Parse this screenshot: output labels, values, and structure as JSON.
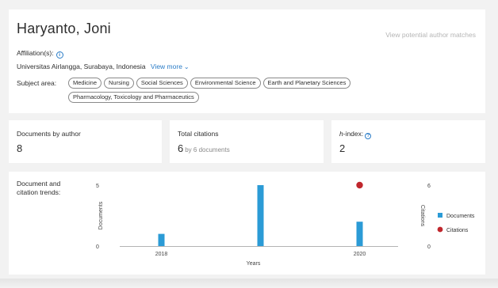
{
  "author": {
    "name": "Haryanto, Joni",
    "potential_matches_link": "View potential author matches",
    "affiliation_label": "Affiliation(s):",
    "affiliation_value": "Universitas Airlangga, Surabaya, Indonesia",
    "view_more": "View more",
    "subject_label": "Subject area:",
    "subjects_row1": [
      "Medicine",
      "Nursing",
      "Social Sciences",
      "Environmental Science",
      "Earth and Planetary Sciences"
    ],
    "subjects_row2": [
      "Pharmacology, Toxicology and Pharmaceutics"
    ]
  },
  "metrics": {
    "documents": {
      "label": "Documents by author",
      "value": "8"
    },
    "citations": {
      "label": "Total citations",
      "value": "6",
      "sub": "by 6 documents"
    },
    "hindex": {
      "label_italic": "h",
      "label_rest": "-index:",
      "value": "2"
    }
  },
  "trends": {
    "label": "Document and citation trends:"
  },
  "colors": {
    "accent": "#2a7cc7",
    "documents": "#2b9bd6",
    "citations": "#c0272d"
  },
  "chart_data": {
    "type": "bar",
    "xlabel": "Years",
    "ylabel_left": "Documents",
    "ylabel_right": "Citations",
    "x_ticks": [
      "2018",
      "2020"
    ],
    "xlim": [
      2017.5,
      2020.5
    ],
    "ylim_left": [
      0,
      5
    ],
    "ylim_right": [
      0,
      6
    ],
    "left_ticks": [
      0,
      5
    ],
    "right_ticks": [
      0,
      6
    ],
    "series": [
      {
        "name": "Documents",
        "type": "bar",
        "axis": "left",
        "x": [
          2018,
          2019,
          2020
        ],
        "values": [
          1,
          5,
          2
        ]
      },
      {
        "name": "Citations",
        "type": "scatter",
        "axis": "right",
        "x": [
          2020
        ],
        "values": [
          6
        ]
      }
    ]
  }
}
